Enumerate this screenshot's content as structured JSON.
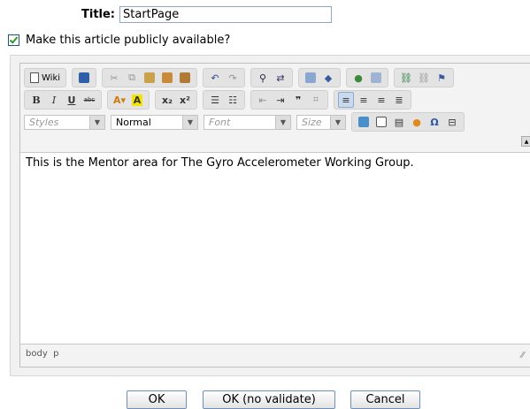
{
  "title_field": {
    "label": "Title:",
    "value": "StartPage"
  },
  "public_option": {
    "label": "Make this article publicly available?",
    "checked": true
  },
  "toolbar": {
    "wiki_label": "Wiki",
    "styles_combo": "Styles",
    "format_combo": "Normal",
    "font_combo": "Font",
    "size_combo": "Size"
  },
  "editor": {
    "content": "This is the Mentor area for The Gyro Accelerometer Working Group.",
    "statusbar": "body  p"
  },
  "buttons": {
    "ok": "OK",
    "ok_no_validate": "OK (no validate)",
    "cancel": "Cancel"
  }
}
